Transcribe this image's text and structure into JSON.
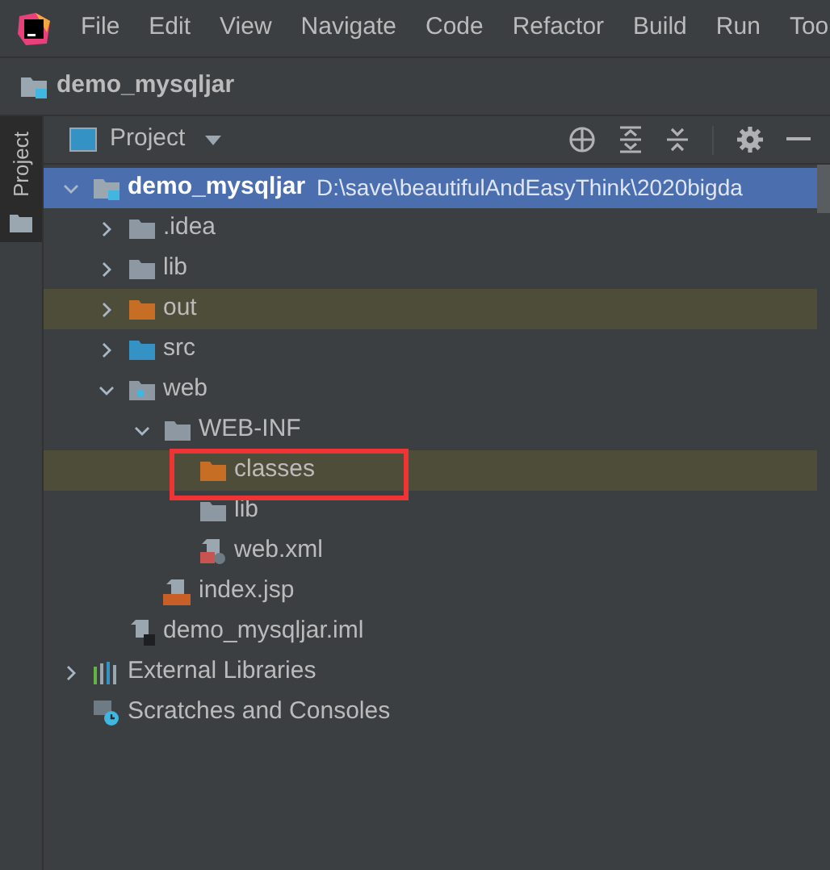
{
  "menu_bar": {
    "items": [
      "File",
      "Edit",
      "View",
      "Navigate",
      "Code",
      "Refactor",
      "Build",
      "Run",
      "Too"
    ]
  },
  "breadcrumb": {
    "label": "demo_mysqljar"
  },
  "tool_stripe": {
    "tabs": [
      {
        "label": "Project",
        "selected": true
      }
    ]
  },
  "project_panel": {
    "view_selector": "Project",
    "tree": [
      {
        "label": "demo_mysqljar",
        "path": "D:\\save\\beautifulAndEasyThink\\2020bigda",
        "kind": "module",
        "expanded": true,
        "selected": true,
        "highlighted": false,
        "children": [
          {
            "label": ".idea",
            "kind": "folder",
            "expanded": false,
            "selected": false,
            "highlighted": false
          },
          {
            "label": "lib",
            "kind": "folder",
            "expanded": false,
            "selected": false,
            "highlighted": false
          },
          {
            "label": "out",
            "kind": "folder-excluded",
            "expanded": false,
            "selected": false,
            "highlighted": true
          },
          {
            "label": "src",
            "kind": "folder-source",
            "expanded": false,
            "selected": false,
            "highlighted": false
          },
          {
            "label": "web",
            "kind": "folder-web",
            "expanded": true,
            "selected": false,
            "highlighted": false,
            "children": [
              {
                "label": "WEB-INF",
                "kind": "folder",
                "expanded": true,
                "selected": false,
                "highlighted": false,
                "children": [
                  {
                    "label": "classes",
                    "kind": "folder-excluded",
                    "selected": false,
                    "highlighted": true
                  },
                  {
                    "label": "lib",
                    "kind": "folder",
                    "selected": false,
                    "highlighted": false
                  },
                  {
                    "label": "web.xml",
                    "kind": "file-xml",
                    "selected": false,
                    "highlighted": false
                  }
                ]
              },
              {
                "label": "index.jsp",
                "kind": "file-jsp",
                "selected": false,
                "highlighted": false
              }
            ]
          },
          {
            "label": "demo_mysqljar.iml",
            "kind": "file-iml",
            "selected": false,
            "highlighted": false
          }
        ]
      },
      {
        "label": "External Libraries",
        "kind": "libraries",
        "expanded": false,
        "selected": false,
        "highlighted": false
      },
      {
        "label": "Scratches and Consoles",
        "kind": "scratches",
        "selected": false,
        "highlighted": false
      }
    ]
  },
  "annotation": {
    "kind": "rectangle",
    "color": "#ee3434"
  }
}
